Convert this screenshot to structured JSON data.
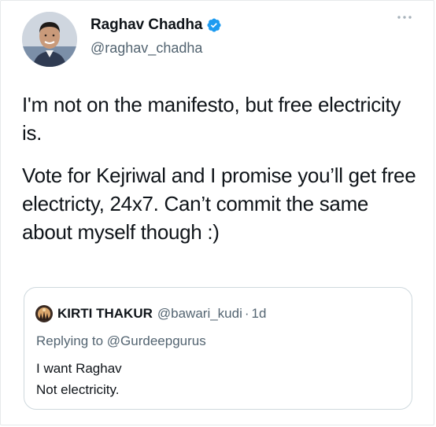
{
  "tweet": {
    "author": {
      "display_name": "Raghav Chadha",
      "handle": "@raghav_chadha",
      "verified": true,
      "avatar_icon": "profile-photo"
    },
    "more_icon": "more-horizontal-icon",
    "paragraphs": [
      "I'm not on the manifesto, but free electricity is.",
      "Vote for Kejriwal and I promise you’ll get free electricty, 24x7. Can’t commit the same about myself though :)"
    ]
  },
  "quoted_tweet": {
    "display_name": "KIRTI THAKUR",
    "handle": "@bawari_kudi",
    "separator": "·",
    "time": "1d",
    "replying_to_prefix": "Replying to",
    "replying_to_handle": "@Gurdeepgurus",
    "body_lines": [
      "I want Raghav",
      "Not electricity."
    ]
  },
  "colors": {
    "text": "#0f1419",
    "secondary_text": "#536471",
    "verified_blue": "#1d9bf0",
    "border": "#cfd9de"
  }
}
